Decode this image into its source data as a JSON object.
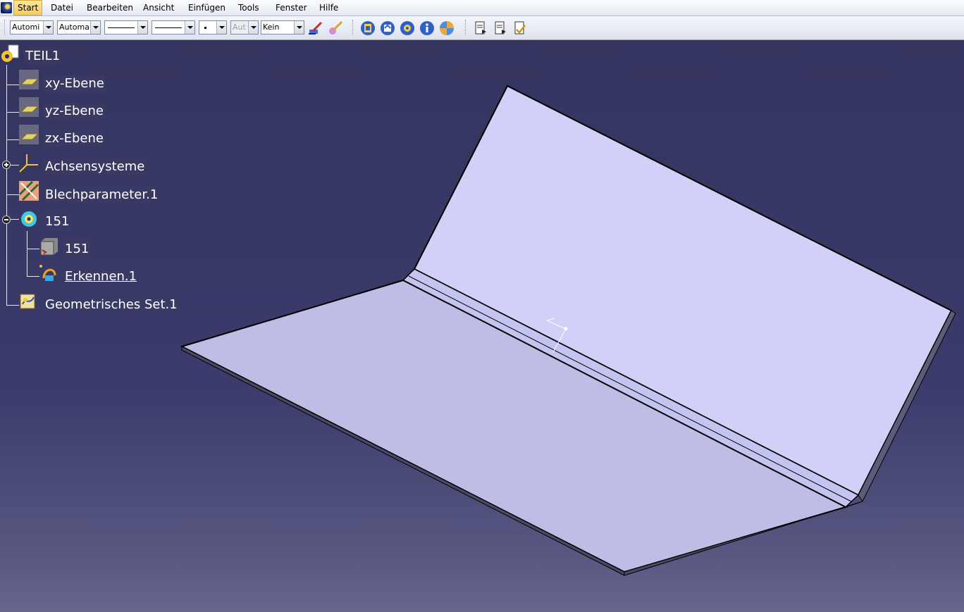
{
  "menubar": {
    "items": [
      {
        "label": "Start",
        "active": true
      },
      {
        "label": "Datei"
      },
      {
        "label": "Bearbeiten"
      },
      {
        "label": "Ansicht"
      },
      {
        "label": "Einfügen"
      },
      {
        "label": "Tools"
      },
      {
        "label": "Fenster"
      },
      {
        "label": "Hilfe"
      }
    ]
  },
  "toolbar": {
    "color_combo": "Automi",
    "transparency_combo": "Automa",
    "layer_combo_disabled": "Aut",
    "layer_combo": "Kein"
  },
  "tree": {
    "root": "TEIL1",
    "xy_plane": "xy-Ebene",
    "yz_plane": "yz-Ebene",
    "zx_plane": "zx-Ebene",
    "axis_systems": "Achsensysteme",
    "sheet_metal_params": "Blechparameter.1",
    "body": "151",
    "body_child": "151",
    "recognize": "Erkennen.1",
    "geom_set": "Geometrisches Set.1"
  },
  "colors": {
    "viewport_bg": "#38386a",
    "part_face": "#d0d0f8",
    "part_face_dark": "#bdbde6"
  }
}
